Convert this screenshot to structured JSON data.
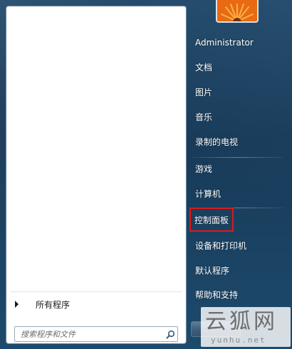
{
  "left_pane": {
    "all_programs_label": "所有程序",
    "search": {
      "placeholder": "搜索程序和文件",
      "icon": "magnifier-icon"
    }
  },
  "user": {
    "name": "Administrator",
    "picture": "flower-icon"
  },
  "right_pane": {
    "items": [
      {
        "label": "Administrator"
      },
      {
        "label": "文档"
      },
      {
        "label": "图片"
      },
      {
        "label": "音乐"
      },
      {
        "label": "录制的电视"
      },
      {
        "label": "游戏"
      },
      {
        "label": "计算机"
      },
      {
        "label": "控制面板",
        "highlighted": true
      },
      {
        "label": "设备和打印机"
      },
      {
        "label": "默认程序"
      },
      {
        "label": "帮助和支持"
      }
    ]
  },
  "watermark": {
    "main": "云狐网",
    "sub": "yunhu.net"
  },
  "colors": {
    "highlight_border": "#e01818",
    "menu_background": "#1e4464"
  }
}
